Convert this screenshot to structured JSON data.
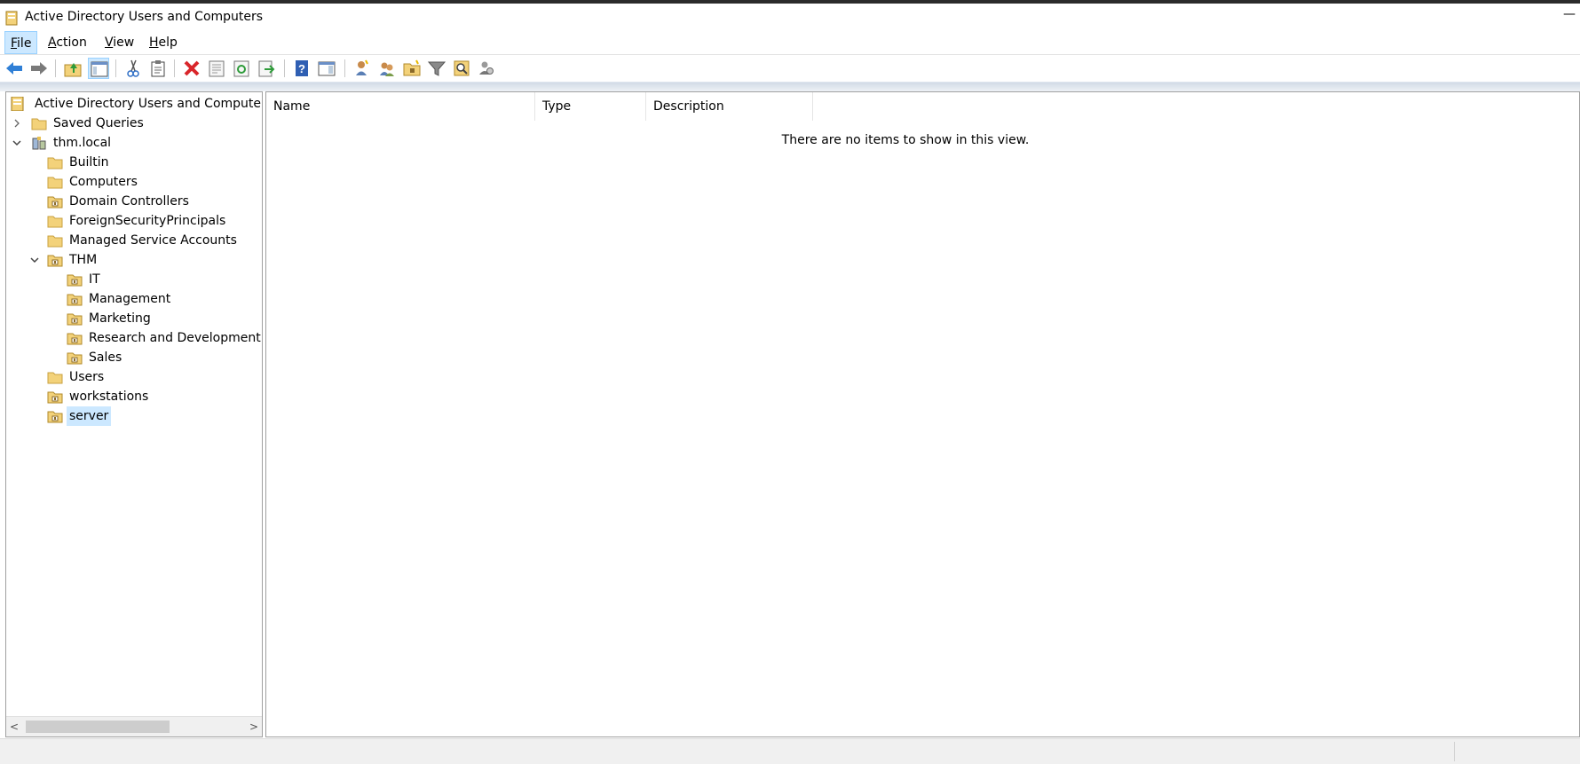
{
  "window": {
    "title": "Active Directory Users and Computers",
    "minimize_glyph": "—"
  },
  "menu": {
    "items": [
      {
        "underline": "F",
        "rest": "ile"
      },
      {
        "underline": "A",
        "rest": "ction"
      },
      {
        "underline": "V",
        "rest": "iew"
      },
      {
        "underline": "H",
        "rest": "elp"
      }
    ]
  },
  "toolbar": {
    "icons": [
      "back-arrow-icon",
      "forward-arrow-icon",
      "up-one-level-icon",
      "show-hide-console-tree-icon",
      "cut-icon",
      "paste-icon",
      "delete-icon",
      "properties-icon",
      "refresh-icon",
      "export-list-icon",
      "help-icon",
      "show-action-pane-icon",
      "create-user-icon",
      "create-group-icon",
      "create-ou-icon",
      "filter-icon",
      "find-icon",
      "add-to-group-icon"
    ]
  },
  "tree": {
    "root": "Active Directory Users and Computers [",
    "saved_queries": "Saved Queries",
    "domain": "thm.local",
    "builtin": "Builtin",
    "computers": "Computers",
    "domain_controllers": "Domain Controllers",
    "fsp": "ForeignSecurityPrincipals",
    "msa": "Managed Service Accounts",
    "thm": "THM",
    "it": "IT",
    "management": "Management",
    "marketing": "Marketing",
    "rnd": "Research and Development",
    "sales": "Sales",
    "users": "Users",
    "workstations": "workstations",
    "server": "server"
  },
  "list": {
    "columns": [
      "Name",
      "Type",
      "Description"
    ],
    "empty_message": "There are no items to show in this view."
  },
  "colors": {
    "selection": "#cce8ff",
    "folder": "#f3d27a",
    "ou_folder": "#e8b94a"
  }
}
